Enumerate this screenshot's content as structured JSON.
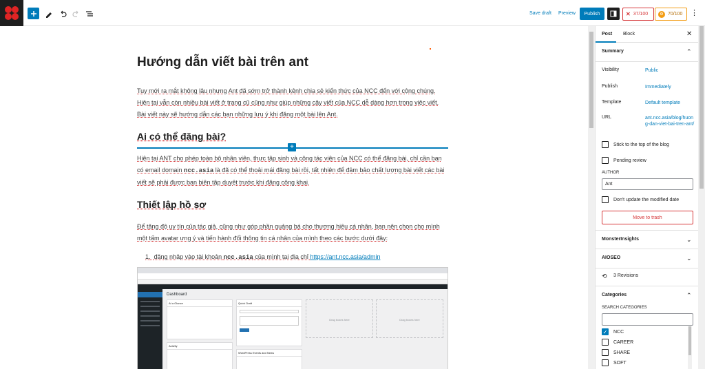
{
  "toolbar": {
    "save_draft": "Save draft",
    "preview": "Preview",
    "publish": "Publish",
    "rankmath_score": "37/100",
    "aioseo_score": "70/100",
    "colors": {
      "accent": "#007cba",
      "danger": "#d63638",
      "warning": "#f39c12"
    }
  },
  "post": {
    "title": "Hướng dẫn viết bài trên ant",
    "intro": "Tuy mới ra mắt không lâu nhưng Ant đã sớm trở thành kênh chia sẻ kiến thức của NCC đến với cộng chúng. Hiện tại vẫn còn nhiều bài viết ở trang cũ cũng như giúp những cây viết của NCC dễ dàng hơn trong việc viết. Bài viết này sẽ hướng dẫn các bạn những lưu ý khi đăng một bài lên Ant.",
    "h_who": "Ai có thể đăng bài?",
    "who_p1": "Hiện tại ANT cho phép toàn bộ nhân viên, thực tập sinh và cộng tác viên của NCC có thể đăng bài, chỉ cần bạn có email domain ",
    "who_domain": "ncc.asia",
    "who_p2": " là đã có thể thoải mái đăng bài rồi, tất nhiên để đảm bảo chất lượng bài viết các bài viết sẽ phải được ban biên tập duyệt trước khi đăng công khai.",
    "h_profile": "Thiết lập hồ sơ",
    "profile_p": "Để tăng độ uy tín của tác giả, cũng như góp phần quảng bá cho thương hiệu cá nhân, bạn nên chọn cho mình một tấm avatar ưng ý và tiến hành đổi thông tin cá nhân của mình theo các bước dưới đây:",
    "step1_num": "1.",
    "step1_a": "đăng nhập vào tài khoản ",
    "step1_b": "ncc.asia",
    "step1_c": " của mình tại địa chỉ ",
    "step1_link": "https://ant.ncc.asia/admin"
  },
  "embed": {
    "dashboard": "Dashboard",
    "at_a_glance": "At a Glance",
    "quick_draft": "Quick Draft",
    "activity": "Activity",
    "wp_events": "WordPress Events and News",
    "drag_here": "Drag boxes here"
  },
  "sidebar": {
    "tab_post": "Post",
    "tab_block": "Block",
    "summary": "Summary",
    "visibility_label": "Visibility",
    "visibility_value": "Public",
    "publish_label": "Publish",
    "publish_value": "Immediately",
    "template_label": "Template",
    "template_value": "Default template",
    "url_label": "URL",
    "url_value": "ant.ncc.asia/blog/huong-dan-viet-bai-tren-ant/",
    "stick_top": "Stick to the top of the blog",
    "pending_review": "Pending review",
    "author_label": "AUTHOR",
    "author_value": "Ant",
    "dont_update": "Don't update the modified date",
    "move_trash": "Move to trash",
    "monsterinsights": "MonsterInsights",
    "aioseo": "AIOSEO",
    "revisions": "3 Revisions",
    "categories": "Categories",
    "search_categories": "SEARCH CATEGORIES",
    "category_items": [
      {
        "label": "NCC",
        "checked": true
      },
      {
        "label": "CAREER",
        "checked": false
      },
      {
        "label": "SHARE",
        "checked": false
      },
      {
        "label": "SOFT",
        "checked": false
      }
    ]
  }
}
